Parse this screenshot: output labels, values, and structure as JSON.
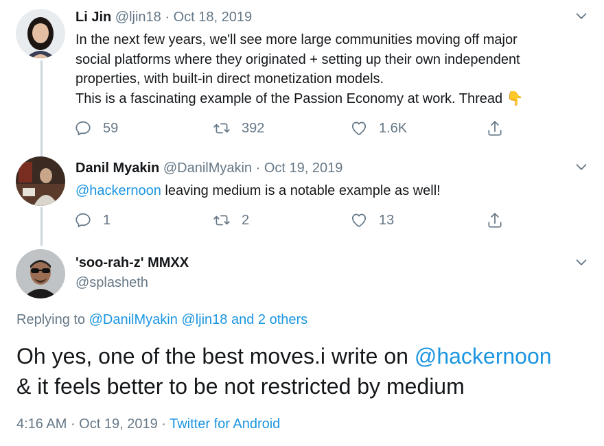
{
  "tweets": [
    {
      "name": "Li Jin",
      "handle": "@ljin18",
      "separator": " · ",
      "date": "Oct 18, 2019",
      "lines": [
        "In the next few years, we'll see more large communities moving off major",
        "social platforms where they originated + setting up their own independent",
        "properties, with built-in direct monetization models.",
        "This is a fascinating example of the Passion Economy at work. Thread "
      ],
      "emoji": "👇",
      "reply_count": "59",
      "retweet_count": "392",
      "like_count": "1.6K"
    },
    {
      "name": "Danil Myakin",
      "handle": "@DanilMyakin",
      "separator": " · ",
      "date": "Oct 19, 2019",
      "mention": "@hackernoon",
      "text": " leaving medium is a notable example as well!",
      "reply_count": "1",
      "retweet_count": "2",
      "like_count": "13"
    }
  ],
  "focus": {
    "name": "'soo-rah-z' MMXX",
    "handle": "@splasheth",
    "replying_prefix": "Replying to ",
    "replying_to": "@DanilMyakin @ljin18 and 2 others",
    "text_before": "Oh yes, one of the best moves.i write on ",
    "mention": "@hackernoon",
    "text_line2": " & it feels better to be not restricted by medium",
    "time": "4:16 AM",
    "separator": " · ",
    "date": "Oct 19, 2019",
    "separator2": " · ",
    "source": "Twitter for Android"
  },
  "icons": {
    "reply": "reply-icon",
    "retweet": "retweet-icon",
    "like": "heart-icon",
    "share": "share-icon",
    "menu": "chevron-down-icon"
  },
  "colors": {
    "link": "#1b95e0",
    "muted": "#657786",
    "text": "#14171a",
    "thread_line": "#ccd6dd"
  }
}
